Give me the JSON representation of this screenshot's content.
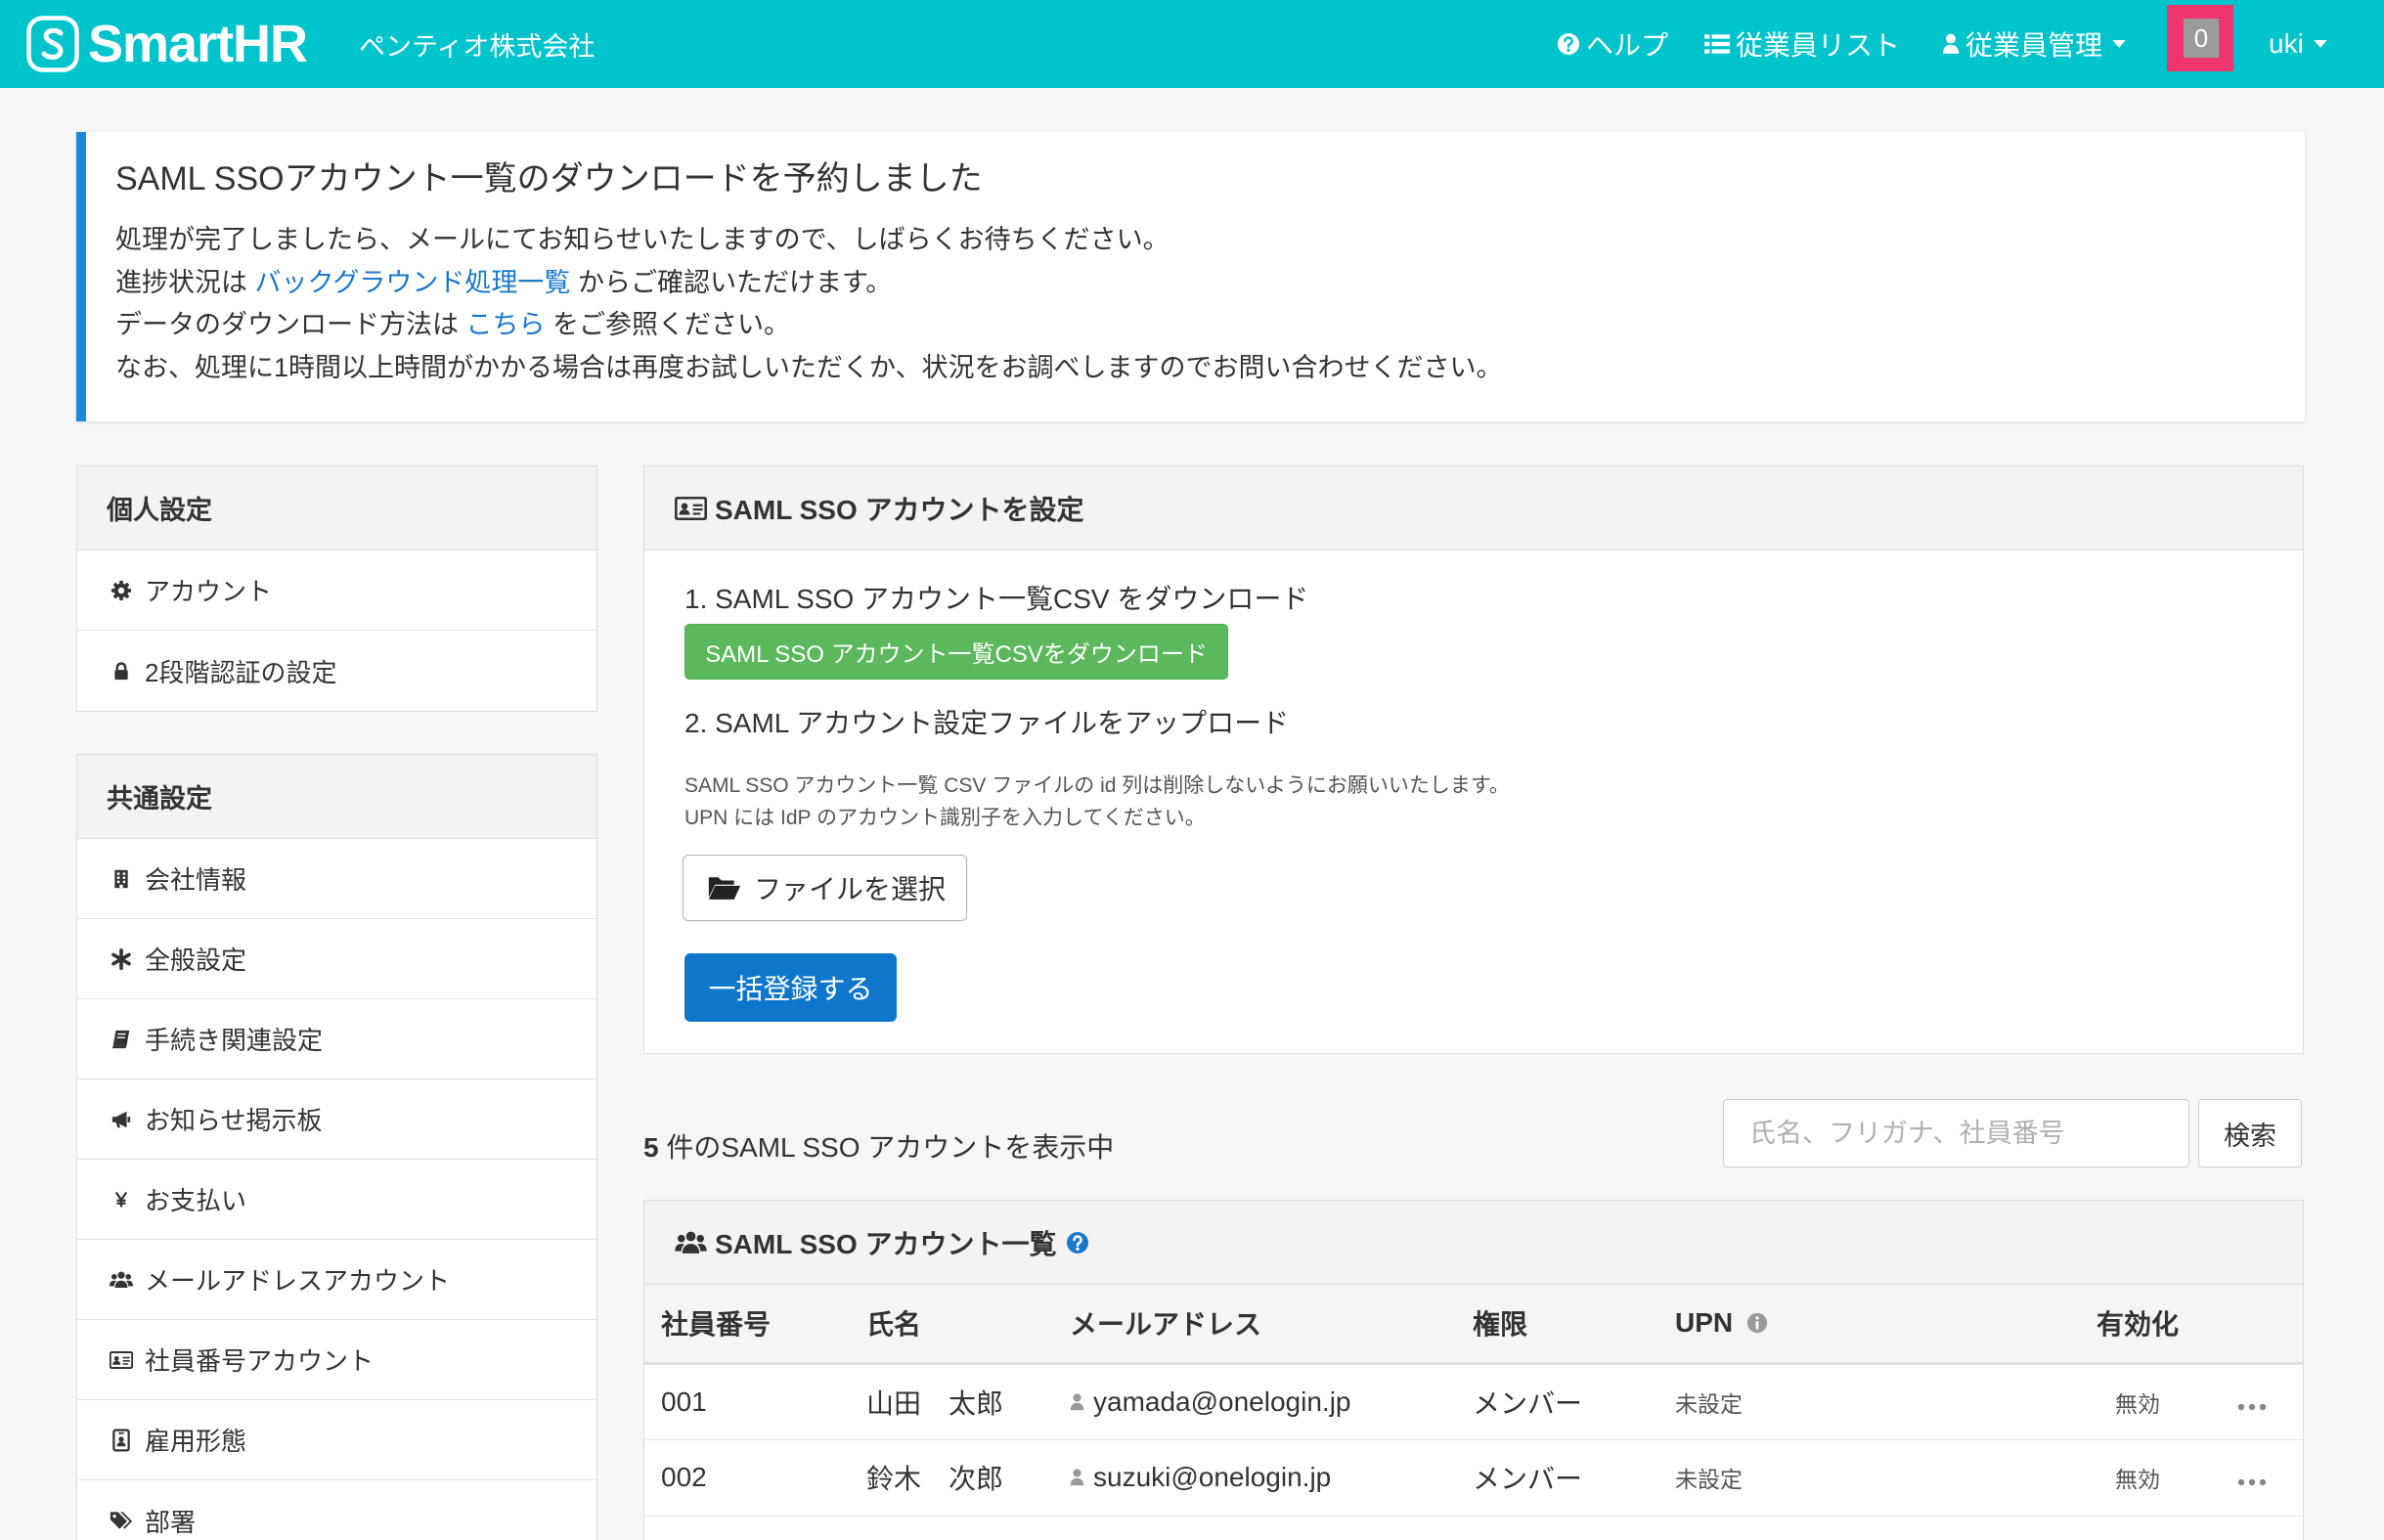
{
  "header": {
    "logo_text": "SmartHR",
    "company_name": "ペンティオ株式会社",
    "nav": {
      "help_label": "ヘルプ",
      "employee_list_label": "従業員リスト",
      "employee_management_label": "従業員管理",
      "notification_count": "0",
      "user_name": "uki"
    },
    "icons": [
      "question-circle-icon",
      "list-icon",
      "user-icon",
      "caret-down-icon"
    ],
    "colors": {
      "bar": "#00c4cc",
      "badge": "#f0346e",
      "badge_inner": "#9b9b9b"
    }
  },
  "alert": {
    "title": "SAML SSOアカウント一覧のダウンロードを予約しました",
    "line1": "処理が完了しましたら、メールにてお知らせいたしますので、しばらくお待ちください。",
    "line2_prefix": "進捗状況は ",
    "line2_link": "バックグラウンド処理一覧",
    "line2_suffix": " からご確認いただけます。",
    "line3_prefix": "データのダウンロード方法は ",
    "line3_link": "こちら",
    "line3_suffix": " をご参照ください。",
    "line4": "なお、処理に1時間以上時間がかかる場合は再度お試しいただくか、状況をお調べしますのでお問い合わせください。",
    "colors": {
      "accent": "#1b87d6",
      "link": "#1a78c9"
    }
  },
  "sidebar": {
    "personal": {
      "title": "個人設定",
      "items": [
        {
          "label": "アカウント",
          "icon": "gear-icon"
        },
        {
          "label": "2段階認証の設定",
          "icon": "lock-icon"
        }
      ]
    },
    "common": {
      "title": "共通設定",
      "items": [
        {
          "label": "会社情報",
          "icon": "building-icon"
        },
        {
          "label": "全般設定",
          "icon": "asterisk-icon"
        },
        {
          "label": "手続き関連設定",
          "icon": "book-icon"
        },
        {
          "label": "お知らせ掲示板",
          "icon": "bullhorn-icon"
        },
        {
          "label": "お支払い",
          "icon": "yen-icon"
        },
        {
          "label": "メールアドレスアカウント",
          "icon": "users-icon"
        },
        {
          "label": "社員番号アカウント",
          "icon": "id-card-icon"
        },
        {
          "label": "雇用形態",
          "icon": "id-badge-icon"
        },
        {
          "label": "部署",
          "icon": "tags-icon"
        }
      ]
    }
  },
  "saml_settings": {
    "title": "SAML SSO アカウントを設定",
    "title_icon": "id-card-icon",
    "step1": "1. SAML SSO アカウント一覧CSV をダウンロード",
    "download_button": "SAML SSO アカウント一覧CSVをダウンロード",
    "step2": "2. SAML アカウント設定ファイルをアップロード",
    "note1": "SAML SSO アカウント一覧 CSV ファイルの id 列は削除しないようにお願いいたします。",
    "note2": "UPN には IdP のアカウント識別子を入力してください。",
    "file_button": "ファイルを選択",
    "file_icon": "folder-open-icon",
    "submit_button": "一括登録する",
    "colors": {
      "download_button": "#5cb85c",
      "submit_button": "#0f77cb"
    }
  },
  "results": {
    "count": "5",
    "count_suffix": " 件のSAML SSO アカウントを表示中",
    "search": {
      "placeholder": "氏名、フリガナ、社員番号",
      "button": "検索"
    }
  },
  "account_table": {
    "title": "SAML SSO アカウント一覧",
    "title_icon": "users-icon",
    "columns": [
      "社員番号",
      "氏名",
      "メールアドレス",
      "権限",
      "UPN",
      "有効化"
    ],
    "rows": [
      {
        "employee_number": "001",
        "name": "山田　太郎",
        "email": "yamada@onelogin.jp",
        "role": "メンバー",
        "upn": "未設定",
        "enabled": "無効"
      },
      {
        "employee_number": "002",
        "name": "鈴木　次郎",
        "email": "suzuki@onelogin.jp",
        "role": "メンバー",
        "upn": "未設定",
        "enabled": "無効"
      }
    ]
  }
}
